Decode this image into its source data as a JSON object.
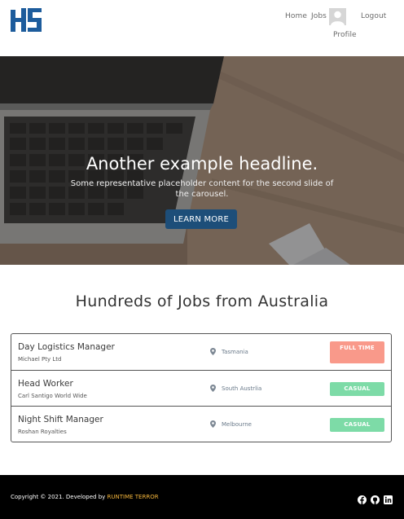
{
  "header": {
    "logo_text": "HS",
    "nav": {
      "home": "Home",
      "jobs": "Jobs",
      "profile": "Profile",
      "logout": "Logout"
    }
  },
  "hero": {
    "title": "Another example headline.",
    "text": "Some representative placeholder content for the second slide of the carousel.",
    "button_label": "LEARN MORE"
  },
  "jobs_section": {
    "title": "Hundreds of Jobs from Australia",
    "jobs": [
      {
        "title": "Day Logistics Manager",
        "company": "Michael Pty Ltd",
        "location": "Tasmania",
        "type": "FULL TIME",
        "type_color": "#f9998a"
      },
      {
        "title": "Head Worker",
        "company": "Carl Santigo World Wide",
        "location": "South Austrlia",
        "type": "CASUAL",
        "type_color": "#7ddba7"
      },
      {
        "title": "Night Shift Manager",
        "company": "Roshan Royalties",
        "location": "Melbourne",
        "type": "CASUAL",
        "type_color": "#7ddba7"
      }
    ]
  },
  "footer": {
    "copyright_prefix": "Copyright © 2021. Developed by",
    "brand": "RUNTIME TERROR",
    "brand_color": "#f6b73c",
    "social_icons": [
      "facebook-icon",
      "github-icon",
      "linkedin-icon"
    ]
  },
  "colors": {
    "primary_button": "#1d4e79",
    "footer_bg": "#000000",
    "logo_blue": "#1d5c9c"
  }
}
